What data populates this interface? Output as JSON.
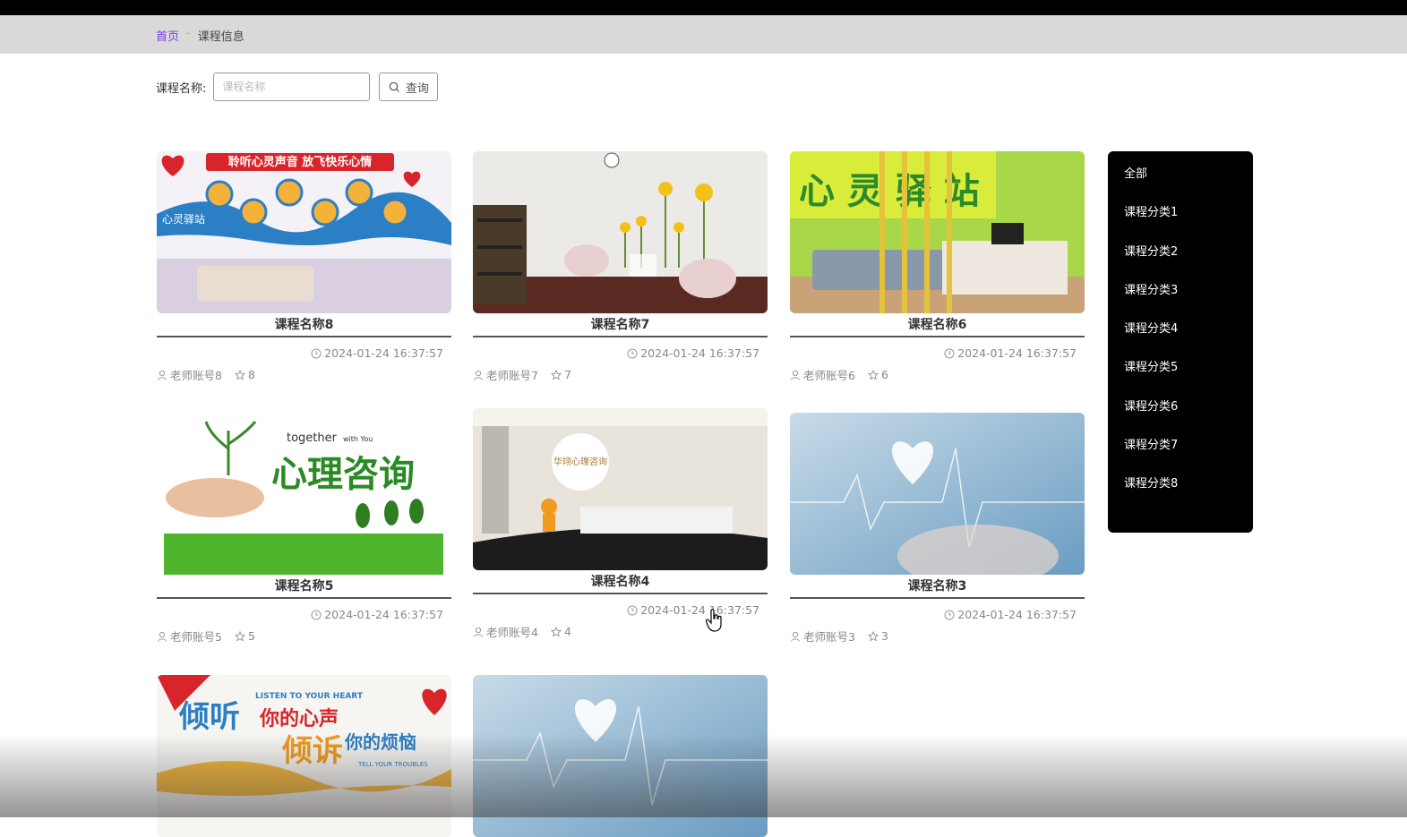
{
  "breadcrumb": {
    "home": "首页",
    "separator": "-",
    "current": "课程信息"
  },
  "search": {
    "label": "课程名称:",
    "placeholder": "课程名称",
    "value": "",
    "button_label": "查询",
    "icon": "search-icon"
  },
  "courses": [
    {
      "title": "课程名称8",
      "time": "2024-01-24 16:37:57",
      "teacher": "老师账号8",
      "likes": "8"
    },
    {
      "title": "课程名称7",
      "time": "2024-01-24 16:37:57",
      "teacher": "老师账号7",
      "likes": "7"
    },
    {
      "title": "课程名称6",
      "time": "2024-01-24 16:37:57",
      "teacher": "老师账号6",
      "likes": "6"
    },
    {
      "title": "课程名称5",
      "time": "2024-01-24 16:37:57",
      "teacher": "老师账号5",
      "likes": "5"
    },
    {
      "title": "课程名称4",
      "time": "2024-01-24 16:37:57",
      "teacher": "老师账号4",
      "likes": "4"
    },
    {
      "title": "课程名称3",
      "time": "2024-01-24 16:37:57",
      "teacher": "老师账号3",
      "likes": "3"
    }
  ],
  "images": {
    "img1": {
      "line1": "聆听心灵声音 放飞快乐心情",
      "badge": "心灵驿站"
    },
    "img3": {
      "headline": "心 灵 驿 站"
    },
    "img4": {
      "small": "together",
      "small2": "with You",
      "headline": "心理咨询"
    },
    "img5": {
      "logo": "华翊心理咨询"
    },
    "img7": {
      "line1": "LISTEN TO YOUR HEART",
      "big1": "倾听",
      "big2": "你的心声",
      "big3": "倾诉",
      "big4": "你的烦恼",
      "line2": "TELL YOUR TROUBLES"
    }
  },
  "categories": [
    "全部",
    "课程分类1",
    "课程分类2",
    "课程分类3",
    "课程分类4",
    "课程分类5",
    "课程分类6",
    "课程分类7",
    "课程分类8"
  ],
  "colors": {
    "accent": "#7b3fe4",
    "sidebar_bg": "#000000",
    "crumb_bar": "#d9d9d9"
  }
}
